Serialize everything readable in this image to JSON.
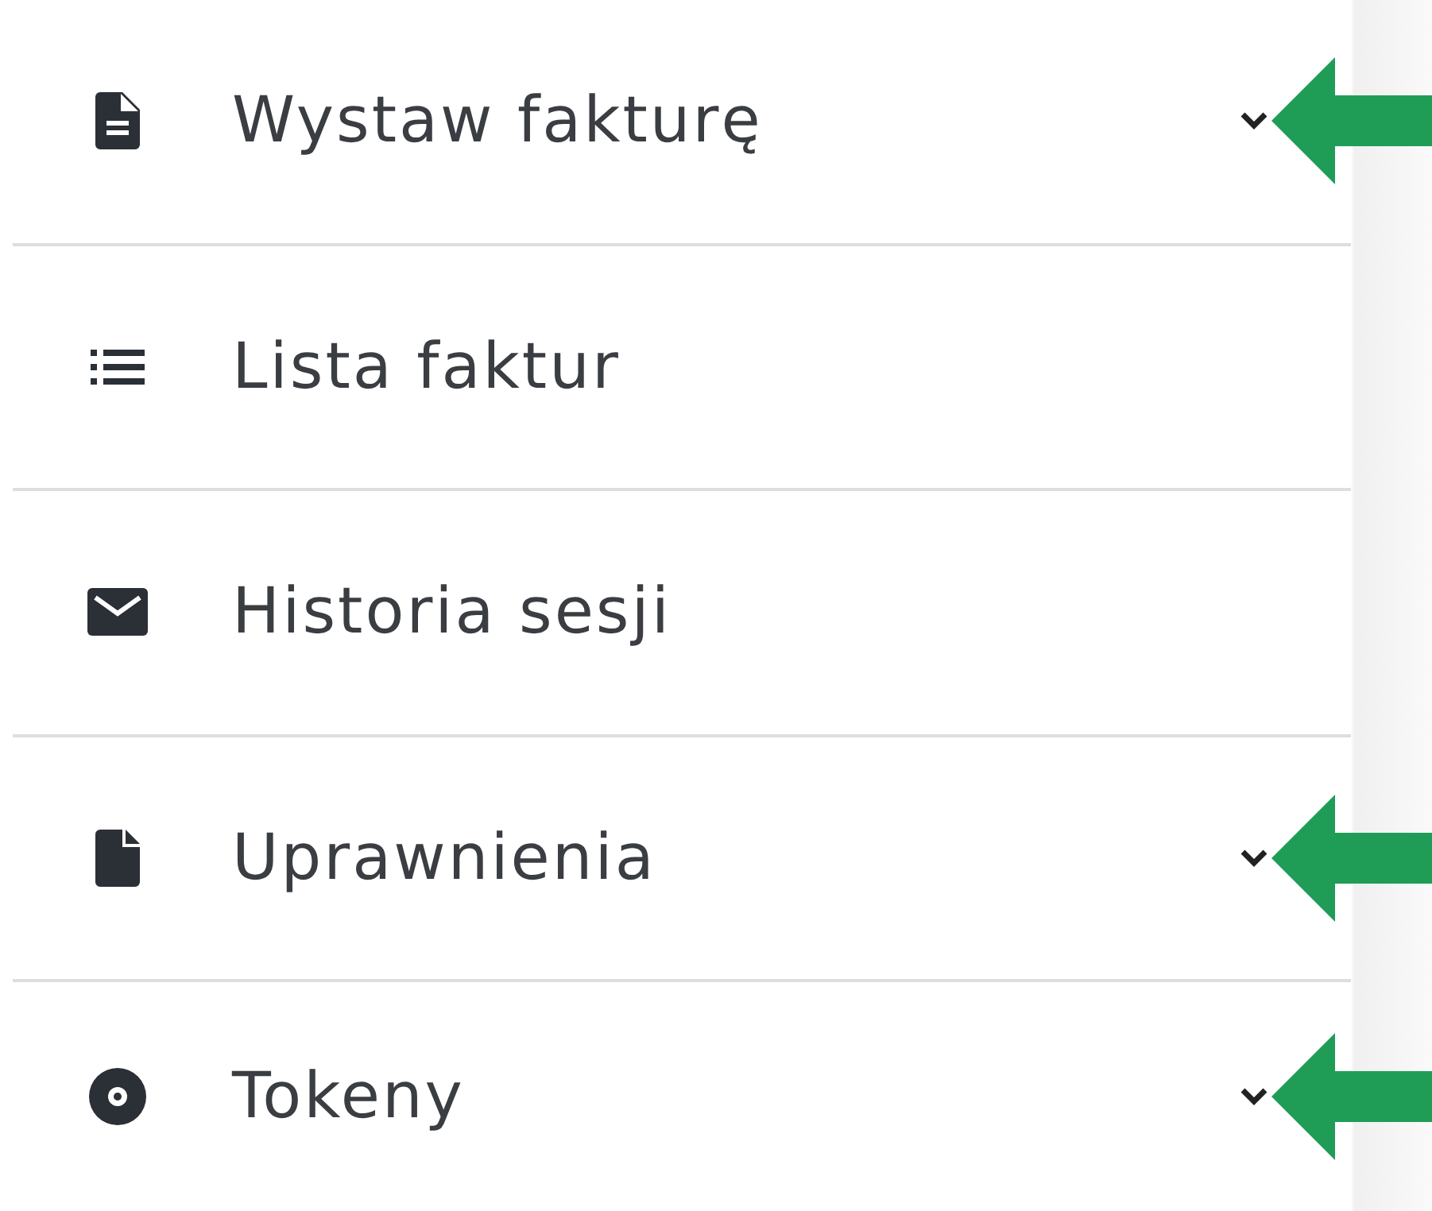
{
  "menu": {
    "items": [
      {
        "label": "Wystaw fakturę",
        "kind": "document",
        "expandable": true,
        "pointed": true
      },
      {
        "label": "Lista faktur",
        "kind": "list",
        "expandable": false,
        "pointed": false
      },
      {
        "label": "Historia sesji",
        "kind": "envelope",
        "expandable": false,
        "pointed": false
      },
      {
        "label": "Uprawnienia",
        "kind": "file",
        "expandable": true,
        "pointed": true
      },
      {
        "label": "Tokeny",
        "kind": "disc",
        "expandable": true,
        "pointed": true
      }
    ]
  }
}
